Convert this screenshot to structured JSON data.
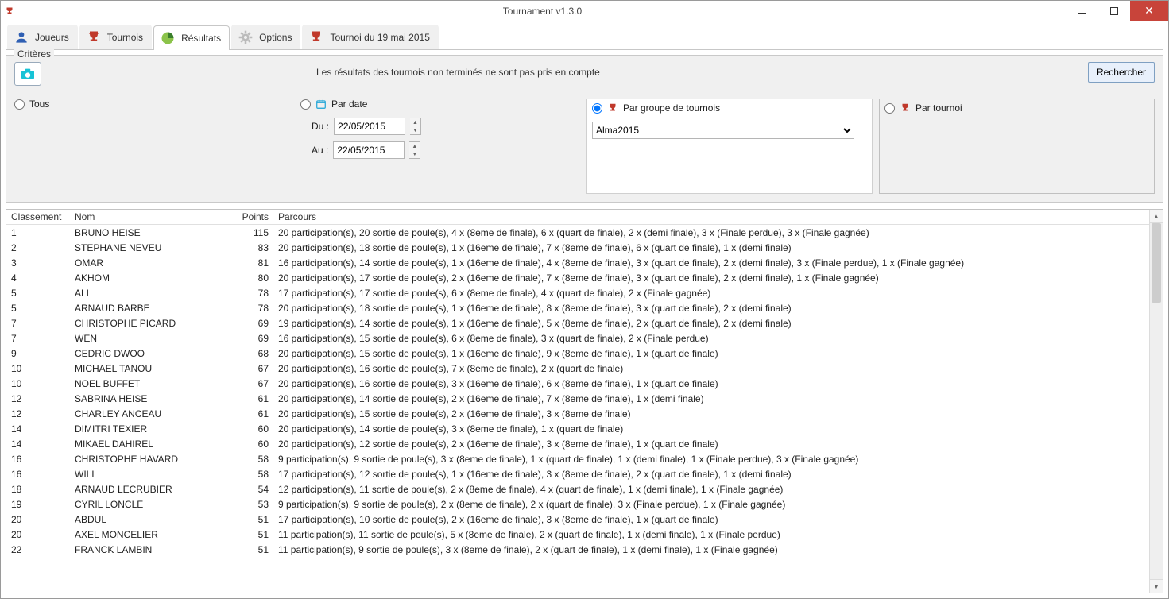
{
  "window": {
    "title": "Tournament v1.3.0"
  },
  "tabs": {
    "players": "Joueurs",
    "tournaments": "Tournois",
    "results": "Résultats",
    "options": "Options",
    "current": "Tournoi du 19 mai 2015"
  },
  "criteria": {
    "legend": "Critères",
    "info": "Les résultats des tournois non terminés ne sont pas pris en compte",
    "search": "Rechercher",
    "all": "Tous",
    "byDate": "Par date",
    "fromLabel": "Du :",
    "toLabel": "Au :",
    "fromValue": "22/05/2015",
    "toValue": "22/05/2015",
    "byGroup": "Par groupe de tournois",
    "groupValue": "Alma2015",
    "byTournament": "Par tournoi"
  },
  "columns": {
    "rank": "Classement",
    "name": "Nom",
    "points": "Points",
    "parcours": "Parcours"
  },
  "rows": [
    {
      "rank": "1",
      "name": "BRUNO HEISE",
      "points": "115",
      "parcours": "20 participation(s),  20 sortie de poule(s),  4 x (8eme de finale),  6 x (quart de finale),  2 x (demi finale),  3 x (Finale perdue),  3 x (Finale gagnée)"
    },
    {
      "rank": "2",
      "name": "STEPHANE NEVEU",
      "points": "83",
      "parcours": "20 participation(s),  18 sortie de poule(s),  1 x (16eme de finale),  7 x (8eme de finale),  6 x (quart de finale),  1 x (demi finale)"
    },
    {
      "rank": "3",
      "name": "OMAR",
      "points": "81",
      "parcours": "16 participation(s),  14 sortie de poule(s),  1 x (16eme de finale),  4 x (8eme de finale),  3 x (quart de finale),  2 x (demi finale),  3 x (Finale perdue),  1 x (Finale gagnée)"
    },
    {
      "rank": "4",
      "name": "AKHOM",
      "points": "80",
      "parcours": "20 participation(s),  17 sortie de poule(s),  2 x (16eme de finale),  7 x (8eme de finale),  3 x (quart de finale),  2 x (demi finale),  1 x (Finale gagnée)"
    },
    {
      "rank": "5",
      "name": "ALI",
      "points": "78",
      "parcours": "17 participation(s),  17 sortie de poule(s),  6 x (8eme de finale),  4 x (quart de finale),  2 x (Finale gagnée)"
    },
    {
      "rank": "5",
      "name": "ARNAUD BARBE",
      "points": "78",
      "parcours": "20 participation(s),  18 sortie de poule(s),  1 x (16eme de finale),  8 x (8eme de finale),  3 x (quart de finale),  2 x (demi finale)"
    },
    {
      "rank": "7",
      "name": "CHRISTOPHE PICARD",
      "points": "69",
      "parcours": "19 participation(s),  14 sortie de poule(s),  1 x (16eme de finale),  5 x (8eme de finale),  2 x (quart de finale),  2 x (demi finale)"
    },
    {
      "rank": "7",
      "name": "WEN",
      "points": "69",
      "parcours": "16 participation(s),  15 sortie de poule(s),  6 x (8eme de finale),  3 x (quart de finale),  2 x (Finale perdue)"
    },
    {
      "rank": "9",
      "name": "CEDRIC DWOO",
      "points": "68",
      "parcours": "20 participation(s),  15 sortie de poule(s),  1 x (16eme de finale),  9 x (8eme de finale),  1 x (quart de finale)"
    },
    {
      "rank": "10",
      "name": "MICHAEL TANOU",
      "points": "67",
      "parcours": "20 participation(s),  16 sortie de poule(s),  7 x (8eme de finale),  2 x (quart de finale)"
    },
    {
      "rank": "10",
      "name": "NOEL BUFFET",
      "points": "67",
      "parcours": "20 participation(s),  16 sortie de poule(s),  3 x (16eme de finale),  6 x (8eme de finale),  1 x (quart de finale)"
    },
    {
      "rank": "12",
      "name": "SABRINA HEISE",
      "points": "61",
      "parcours": "20 participation(s),  14 sortie de poule(s),  2 x (16eme de finale),  7 x (8eme de finale),  1 x (demi finale)"
    },
    {
      "rank": "12",
      "name": "CHARLEY ANCEAU",
      "points": "61",
      "parcours": "20 participation(s),  15 sortie de poule(s),  2 x (16eme de finale),  3 x (8eme de finale)"
    },
    {
      "rank": "14",
      "name": "DIMITRI TEXIER",
      "points": "60",
      "parcours": "20 participation(s),  14 sortie de poule(s),  3 x (8eme de finale),  1 x (quart de finale)"
    },
    {
      "rank": "14",
      "name": "MIKAEL DAHIREL",
      "points": "60",
      "parcours": "20 participation(s),  12 sortie de poule(s),  2 x (16eme de finale),  3 x (8eme de finale),  1 x (quart de finale)"
    },
    {
      "rank": "16",
      "name": "CHRISTOPHE HAVARD",
      "points": "58",
      "parcours": "9 participation(s),  9 sortie de poule(s),  3 x (8eme de finale),  1 x (quart de finale),  1 x (demi finale),  1 x (Finale perdue),  3 x (Finale gagnée)"
    },
    {
      "rank": "16",
      "name": "WILL",
      "points": "58",
      "parcours": "17 participation(s),  12 sortie de poule(s),  1 x (16eme de finale),  3 x (8eme de finale),  2 x (quart de finale),  1 x (demi finale)"
    },
    {
      "rank": "18",
      "name": "ARNAUD LECRUBIER",
      "points": "54",
      "parcours": "12 participation(s),  11 sortie de poule(s),  2 x (8eme de finale),  4 x (quart de finale),  1 x (demi finale),  1 x (Finale gagnée)"
    },
    {
      "rank": "19",
      "name": "CYRIL LONCLE",
      "points": "53",
      "parcours": "9 participation(s),  9 sortie de poule(s),  2 x (8eme de finale),  2 x (quart de finale),  3 x (Finale perdue),  1 x (Finale gagnée)"
    },
    {
      "rank": "20",
      "name": "ABDUL",
      "points": "51",
      "parcours": "17 participation(s),  10 sortie de poule(s),  2 x (16eme de finale),  3 x (8eme de finale),  1 x (quart de finale)"
    },
    {
      "rank": "20",
      "name": "AXEL MONCELIER",
      "points": "51",
      "parcours": "11 participation(s),  11 sortie de poule(s),  5 x (8eme de finale),  2 x (quart de finale),  1 x (demi finale),  1 x (Finale perdue)"
    },
    {
      "rank": "22",
      "name": "FRANCK LAMBIN",
      "points": "51",
      "parcours": "11 participation(s),  9 sortie de poule(s),  3 x (8eme de finale),  2 x (quart de finale),  1 x (demi finale),  1 x (Finale gagnée)"
    }
  ]
}
